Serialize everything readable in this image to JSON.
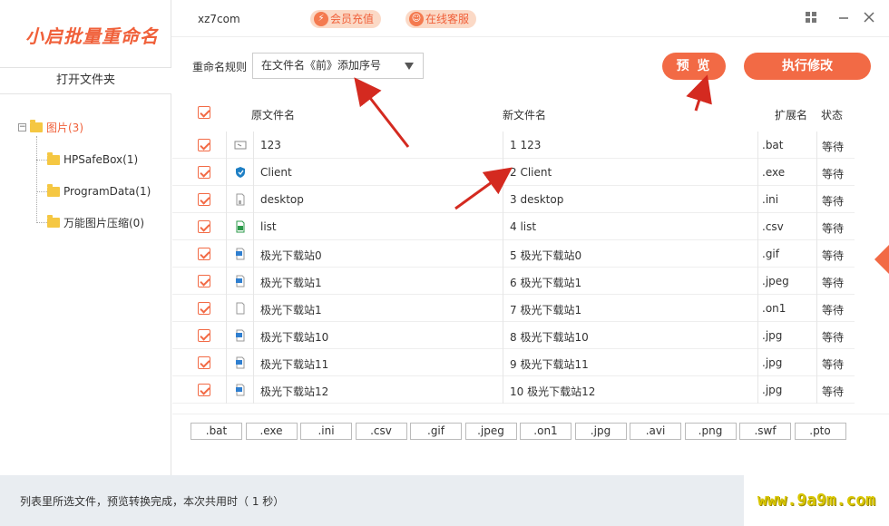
{
  "app": {
    "logo": "小启批量重命名",
    "site": "xz7com",
    "badges": [
      {
        "name": "vip",
        "label": "会员充值",
        "icon": "lightning-icon"
      },
      {
        "name": "service",
        "label": "在线客服",
        "icon": "support-icon"
      }
    ]
  },
  "sidebar": {
    "open_folder_label": "打开文件夹",
    "tree": {
      "root": {
        "label": "图片(3)",
        "expander": "⊟"
      },
      "children": [
        {
          "label": "HPSafeBox(1)"
        },
        {
          "label": "ProgramData(1)"
        },
        {
          "label": "万能图片压缩(0)"
        }
      ]
    }
  },
  "toolbar": {
    "rule_label": "重命名规则",
    "rule_value": "在文件名《前》添加序号",
    "preview_label": "预 览",
    "execute_label": "执行修改"
  },
  "table": {
    "headers": {
      "original": "原文件名",
      "new": "新文件名",
      "ext": "扩展名",
      "status": "状态"
    },
    "rows": [
      {
        "icon": "bat-file-icon",
        "original": "123",
        "new": "1 123",
        "ext": ".bat",
        "status": "等待"
      },
      {
        "icon": "shield-file-icon",
        "original": "Client",
        "new": "2 Client",
        "ext": ".exe",
        "status": "等待"
      },
      {
        "icon": "ini-file-icon",
        "original": "desktop",
        "new": "3 desktop",
        "ext": ".ini",
        "status": "等待"
      },
      {
        "icon": "csv-file-icon",
        "original": "list",
        "new": "4 list",
        "ext": ".csv",
        "status": "等待"
      },
      {
        "icon": "image-file-icon",
        "original": "极光下载站0",
        "new": "5 极光下载站0",
        "ext": ".gif",
        "status": "等待"
      },
      {
        "icon": "image-file-icon",
        "original": "极光下载站1",
        "new": "6 极光下载站1",
        "ext": ".jpeg",
        "status": "等待"
      },
      {
        "icon": "blank-file-icon",
        "original": "极光下载站1",
        "new": "7 极光下载站1",
        "ext": ".on1",
        "status": "等待"
      },
      {
        "icon": "image-file-icon",
        "original": "极光下载站10",
        "new": "8 极光下载站10",
        "ext": ".jpg",
        "status": "等待"
      },
      {
        "icon": "image-file-icon",
        "original": "极光下载站11",
        "new": "9 极光下载站11",
        "ext": ".jpg",
        "status": "等待"
      },
      {
        "icon": "image-file-icon",
        "original": "极光下载站12",
        "new": "10 极光下载站12",
        "ext": ".jpg",
        "status": "等待"
      }
    ]
  },
  "ext_filters": [
    ".bat",
    ".exe",
    ".ini",
    ".csv",
    ".gif",
    ".jpeg",
    ".on1",
    ".jpg",
    ".avi",
    ".png",
    ".swf",
    ".pto"
  ],
  "status_bar": {
    "text": "列表里所选文件，预览转换完成，本次共用时（ 1 秒）"
  },
  "watermark": "www.9a9m.com",
  "colors": {
    "accent": "#f26a45",
    "folder": "#f5c742",
    "status_bg": "#e9edf1",
    "arrow": "#d42a20"
  }
}
